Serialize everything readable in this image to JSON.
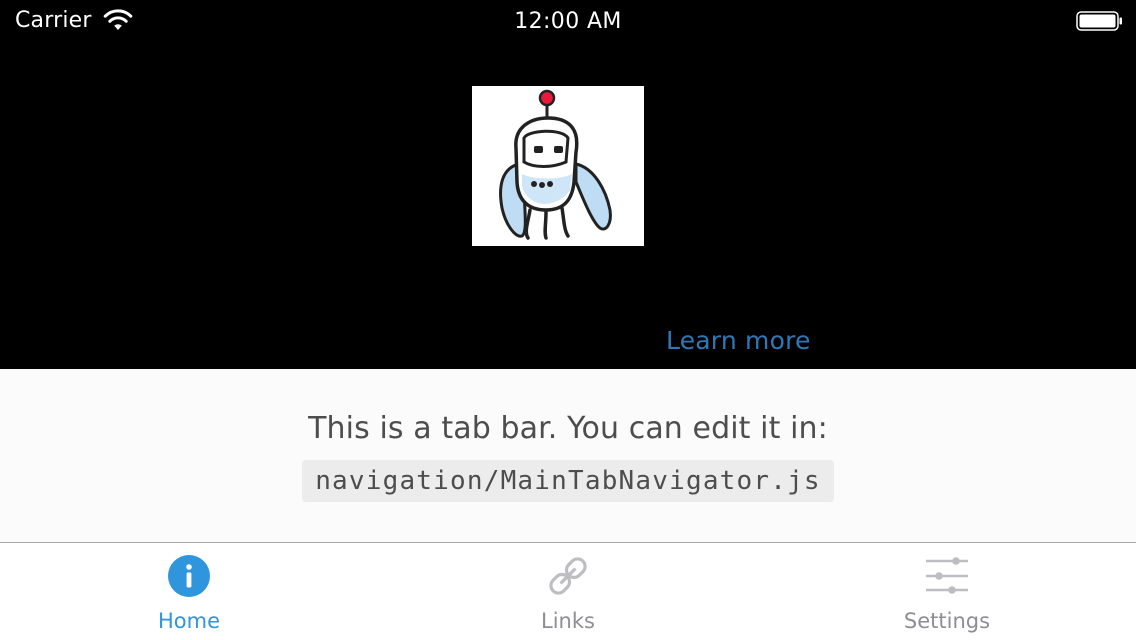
{
  "status_bar": {
    "carrier": "Carrier",
    "time": "12:00 AM",
    "wifi_icon": "wifi-icon",
    "battery_icon": "battery-icon"
  },
  "home": {
    "logo_icon": "robot-logo",
    "learn_more": "Learn more",
    "link_color": "#2e78b7"
  },
  "tab_bar_info": {
    "text": "This is a tab bar. You can edit it in:",
    "code_path": "navigation/MainTabNavigator.js"
  },
  "tabs": [
    {
      "label": "Home",
      "icon": "info-icon",
      "active": true
    },
    {
      "label": "Links",
      "icon": "link-icon",
      "active": false
    },
    {
      "label": "Settings",
      "icon": "settings-sliders-icon",
      "active": false
    }
  ],
  "colors": {
    "active_tab": "#2f95dc",
    "inactive_tab": "#8e8e93",
    "background": "#000000",
    "info_background": "#fbfbfb"
  }
}
